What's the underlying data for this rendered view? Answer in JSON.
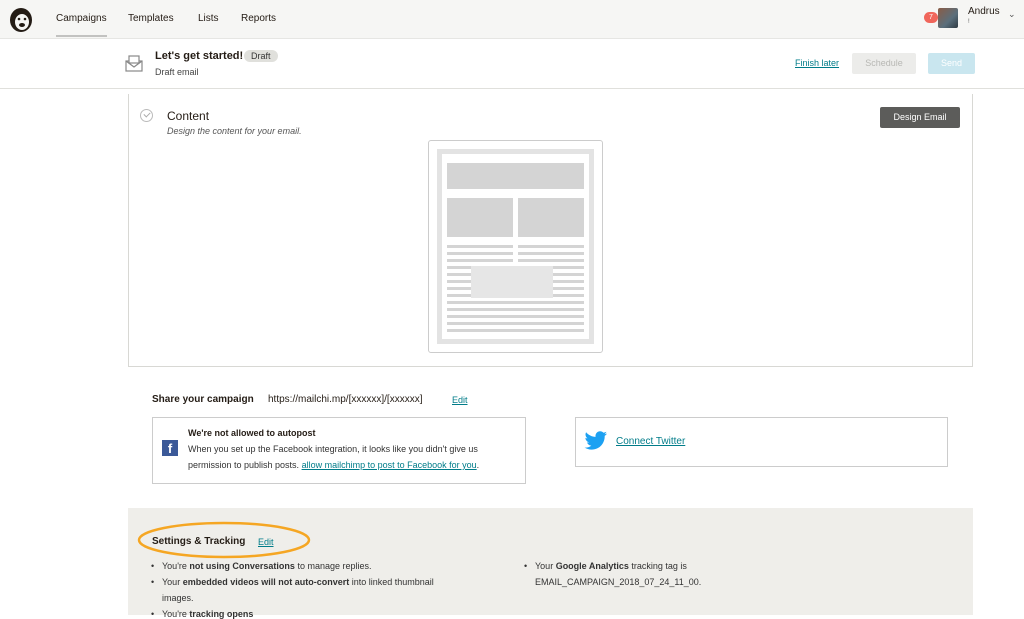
{
  "nav": {
    "items": [
      "Campaigns",
      "Templates",
      "Lists",
      "Reports"
    ],
    "notification_count": "7",
    "user_name": "Andrus",
    "user_sub": "!"
  },
  "subbar": {
    "title": "Let's get started!",
    "badge": "Draft",
    "subtitle": "Draft email",
    "finish_later": "Finish later",
    "schedule": "Schedule",
    "send": "Send"
  },
  "content": {
    "title": "Content",
    "subtitle": "Design the content for your email.",
    "design_button": "Design Email"
  },
  "share": {
    "label": "Share your campaign",
    "url": "https://mailchi.mp/[xxxxxx]/[xxxxxx]",
    "edit": "Edit"
  },
  "facebook": {
    "title": "We're not allowed to autopost",
    "line1": "When you set up the Facebook integration, it looks like you didn't give us",
    "line2_prefix": "permission to publish posts.",
    "link": "allow mailchimp to post to Facebook for you",
    "line2_suffix": "."
  },
  "twitter": {
    "link": "Connect Twitter"
  },
  "settings": {
    "title": "Settings & Tracking",
    "edit": "Edit",
    "left": [
      {
        "pre": "You're ",
        "bold": "not using Conversations",
        "post": " to manage replies."
      },
      {
        "pre": "Your ",
        "bold": "embedded videos will not auto-convert",
        "post": " into linked thumbnail"
      },
      {
        "pre": "images.",
        "bold": "",
        "post": ""
      },
      {
        "pre": "You're ",
        "bold": "tracking opens",
        "post": ""
      }
    ],
    "right": [
      {
        "pre": "Your ",
        "bold": "Google Analytics",
        "post": " tracking tag is"
      },
      {
        "pre": "EMAIL_CAMPAIGN_2018_07_24_11_00.",
        "bold": "",
        "post": ""
      }
    ]
  }
}
